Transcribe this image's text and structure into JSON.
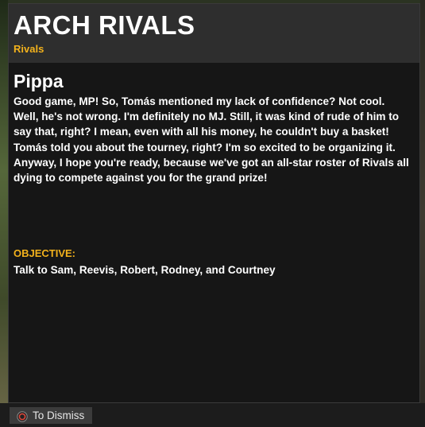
{
  "header": {
    "title": "ARCH RIVALS",
    "subtitle": "Rivals"
  },
  "dialogue": {
    "speaker": "Pippa",
    "text": "Good game, MP! So, Tomás mentioned my lack of confidence? Not cool. Well, he's not wrong. I'm definitely no MJ. Still, it was kind of rude of him to say that, right? I mean, even with all his money, he couldn't buy a basket! Tomás told you about the tourney, right? I'm so excited to be organizing it. Anyway, I hope you're ready, because we've got an all-star roster of Rivals all dying to compete against you for the grand prize!"
  },
  "objective": {
    "label": "OBJECTIVE:",
    "text": "Talk to Sam, Reevis, Robert, Rodney, and Courtney"
  },
  "footer": {
    "dismiss_icon": "circle-button-icon",
    "dismiss_label": "To Dismiss"
  },
  "colors": {
    "accent": "#f3b21c",
    "panel": "#161616",
    "header": "#2e2e2e",
    "button_ring": "#c0392b"
  }
}
